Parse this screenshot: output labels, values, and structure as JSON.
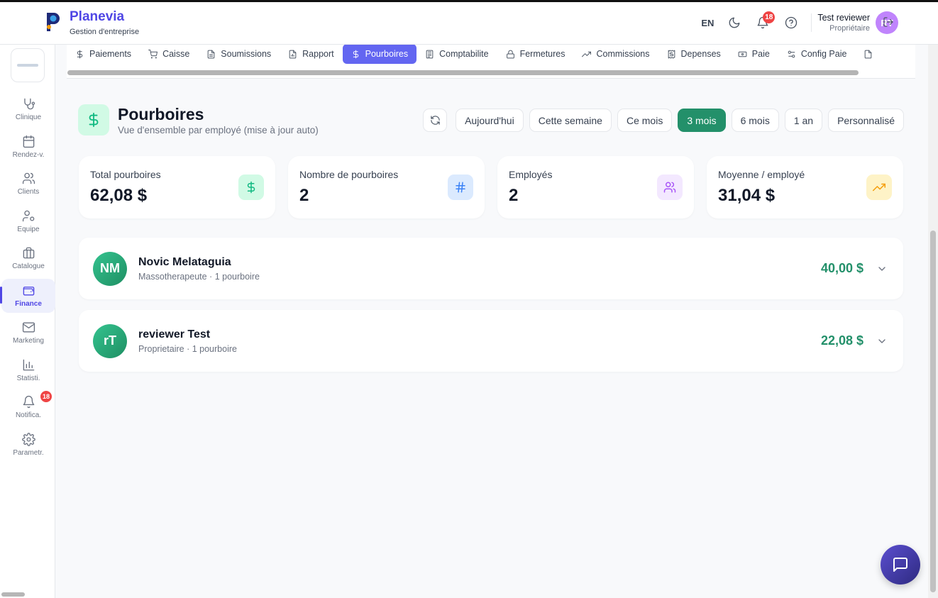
{
  "app": {
    "name": "Planevia",
    "subtitle": "Gestion d'entreprise"
  },
  "topbar": {
    "language": "EN",
    "notifications_count": "18",
    "user_name": "Test reviewer",
    "user_role": "Propriétaire",
    "user_initials": "RT"
  },
  "sidebar": {
    "items": [
      {
        "label": "Clinique",
        "icon": "stethoscope-icon"
      },
      {
        "label": "Rendez-v.",
        "icon": "calendar-icon"
      },
      {
        "label": "Clients",
        "icon": "users-icon"
      },
      {
        "label": "Equipe",
        "icon": "user-cog-icon"
      },
      {
        "label": "Catalogue",
        "icon": "briefcase-icon"
      },
      {
        "label": "Finance",
        "icon": "wallet-icon",
        "active": true
      },
      {
        "label": "Marketing",
        "icon": "mail-icon"
      },
      {
        "label": "Statisti.",
        "icon": "bar-chart-icon"
      },
      {
        "label": "Notifica.",
        "icon": "bell-icon",
        "badge": "18"
      },
      {
        "label": "Parametr.",
        "icon": "settings-icon"
      }
    ]
  },
  "tabs": [
    {
      "label": "Paiements",
      "icon": "dollar-icon"
    },
    {
      "label": "Caisse",
      "icon": "cart-icon"
    },
    {
      "label": "Soumissions",
      "icon": "file-icon"
    },
    {
      "label": "Rapport",
      "icon": "report-icon"
    },
    {
      "label": "Pourboires",
      "icon": "dollar-icon",
      "active": true
    },
    {
      "label": "Comptabilite",
      "icon": "calculator-icon"
    },
    {
      "label": "Fermetures",
      "icon": "lock-icon"
    },
    {
      "label": "Commissions",
      "icon": "trending-up-icon"
    },
    {
      "label": "Depenses",
      "icon": "receipt-icon"
    },
    {
      "label": "Paie",
      "icon": "banknote-icon"
    },
    {
      "label": "Config Paie",
      "icon": "sliders-icon"
    }
  ],
  "page": {
    "title": "Pourboires",
    "subtitle": "Vue d'ensemble par employé (mise à jour auto)"
  },
  "filters": {
    "options": [
      "Aujourd'hui",
      "Cette semaine",
      "Ce mois",
      "3 mois",
      "6 mois",
      "1 an",
      "Personnalisé"
    ],
    "selected": "3 mois"
  },
  "stats": [
    {
      "label": "Total pourboires",
      "value": "62,08 $",
      "icon": "dollar-icon",
      "bg": "#d1fae5",
      "fg": "#10b981"
    },
    {
      "label": "Nombre de pourboires",
      "value": "2",
      "icon": "hash-icon",
      "bg": "#dbeafe",
      "fg": "#3b82f6"
    },
    {
      "label": "Employés",
      "value": "2",
      "icon": "users-icon",
      "bg": "#f3e8ff",
      "fg": "#a855f7"
    },
    {
      "label": "Moyenne / employé",
      "value": "31,04 $",
      "icon": "trending-up-icon",
      "bg": "#fef3c7",
      "fg": "#f59e0b"
    }
  ],
  "employees": [
    {
      "initials": "NM",
      "name": "Novic Melataguia",
      "meta": "Massotherapeute · 1 pourboire",
      "amount": "40,00 $"
    },
    {
      "initials": "rT",
      "name": "reviewer Test",
      "meta": "Proprietaire · 1 pourboire",
      "amount": "22,08 $"
    }
  ],
  "colors": {
    "brand": "#4f46e5",
    "active_tab": "#6366f1",
    "success": "#23906a"
  }
}
